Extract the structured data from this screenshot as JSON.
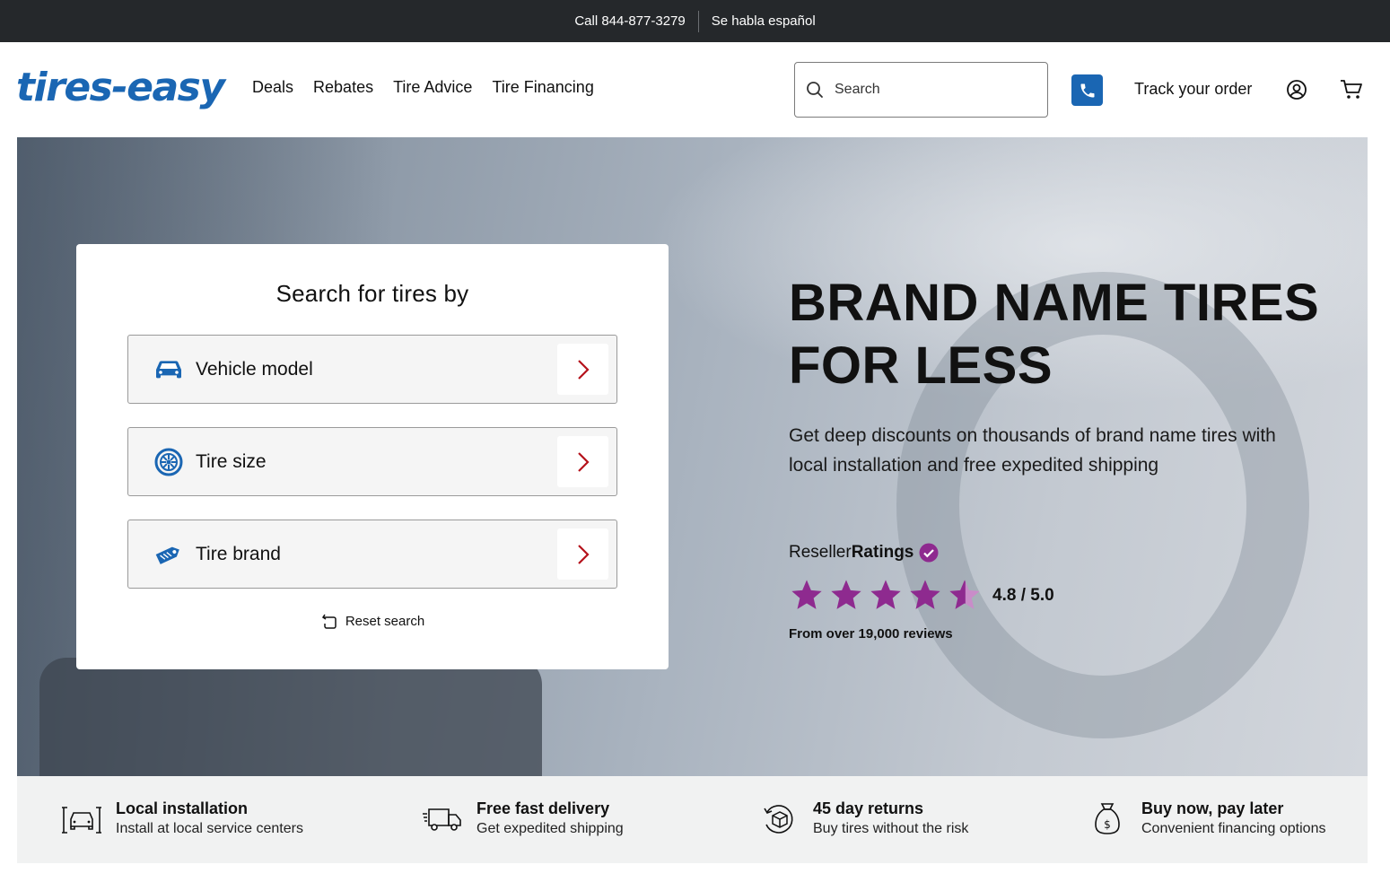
{
  "topbar": {
    "call": "Call 844-877-3279",
    "spanish": "Se habla español"
  },
  "header": {
    "logo": "tires-easy",
    "nav": [
      "Deals",
      "Rebates",
      "Tire Advice",
      "Tire Financing"
    ],
    "search_placeholder": "Search",
    "track_order": "Track your order"
  },
  "search_card": {
    "title": "Search for tires by",
    "options": [
      {
        "label": "Vehicle model",
        "icon": "car-icon"
      },
      {
        "label": "Tire size",
        "icon": "tire-icon"
      },
      {
        "label": "Tire brand",
        "icon": "tag-icon"
      }
    ],
    "reset": "Reset search"
  },
  "hero": {
    "headline_line1": "BRAND NAME TIRES",
    "headline_line2": "FOR LESS",
    "subline": "Get deep discounts on thousands of brand name tires with local installation and free expedited shipping",
    "ratings_brand_a": "Reseller",
    "ratings_brand_b": "Ratings",
    "rating": "4.8 / 5.0",
    "stars": 4.8,
    "reviews": "From over 19,000 reviews"
  },
  "features": [
    {
      "title": "Local installation",
      "desc": "Install at local service centers",
      "icon": "garage-icon"
    },
    {
      "title": "Free fast delivery",
      "desc": "Get expedited shipping",
      "icon": "truck-icon"
    },
    {
      "title": "45 day returns",
      "desc": "Buy tires without the risk",
      "icon": "return-box-icon"
    },
    {
      "title": "Buy now, pay later",
      "desc": "Convenient financing options",
      "icon": "money-bag-icon"
    }
  ],
  "colors": {
    "brand_blue": "#1a66b3",
    "arrow_red": "#b5121b",
    "star_purple": "#8e2a8f",
    "topbar": "#25282b"
  }
}
